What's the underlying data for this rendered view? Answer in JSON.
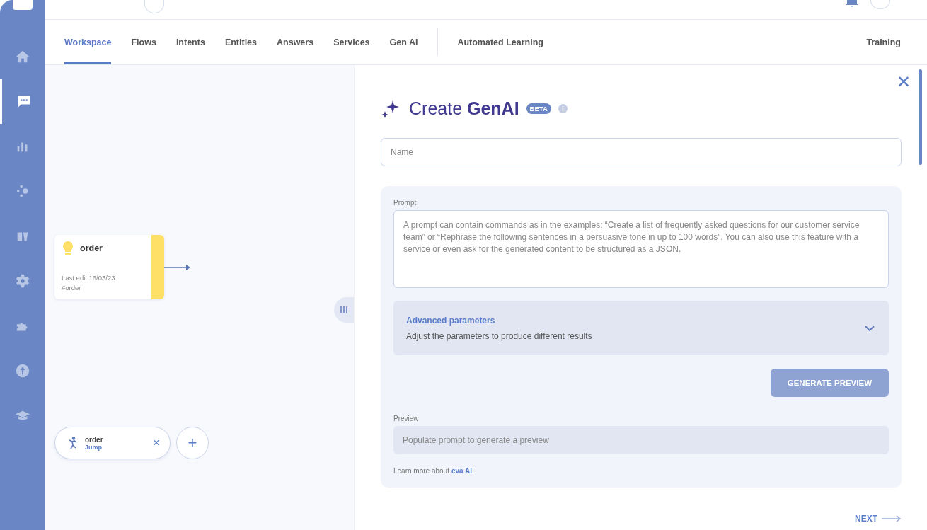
{
  "sidebar": {
    "items": [
      {
        "selected": false
      },
      {
        "selected": true
      },
      {
        "selected": false
      },
      {
        "selected": false
      },
      {
        "selected": false
      },
      {
        "selected": false
      },
      {
        "selected": false
      },
      {
        "selected": false
      },
      {
        "selected": false
      }
    ]
  },
  "tabs": [
    {
      "label": "Workspace",
      "selected": true
    },
    {
      "label": "Flows",
      "selected": false
    },
    {
      "label": "Intents",
      "selected": false
    },
    {
      "label": "Entities",
      "selected": false
    },
    {
      "label": "Answers",
      "selected": false
    },
    {
      "label": "Services",
      "selected": false
    },
    {
      "label": "Gen AI",
      "selected": false
    }
  ],
  "extra_tabs": [
    {
      "label": "Automated Learning",
      "selected": false
    }
  ],
  "right_tabs": [
    {
      "label": "Training",
      "selected": false
    }
  ],
  "canvas": {
    "node": {
      "title": "order",
      "last_edit": "Last edit 16/03/23",
      "tag": "#order",
      "color": "#ffe066"
    },
    "jump": {
      "title": "order",
      "subtitle": "Jump",
      "close": "×"
    },
    "add": "+"
  },
  "panel": {
    "close": "✕",
    "title": "Create **GenAI**",
    "badge": "BETA",
    "name_field": {
      "placeholder": "Name"
    },
    "prompt": {
      "label": "Prompt",
      "placeholder": "A prompt can contain commands as in the examples: “Create a list of frequently asked questions for our customer service team” or “Rephrase the following sentences in a persuasive tone in up to 100 words”. You can also use this feature with a service or even ask for the generated content to be structured as a JSON."
    },
    "advanced": {
      "title": "Advanced parameters",
      "subtitle": "Adjust the parameters to produce different results",
      "expanded": false
    },
    "generate": {
      "label": "GENERATE PREVIEW",
      "disabled": true
    },
    "preview": {
      "label": "Preview",
      "placeholder": "Populate prompt to generate a preview"
    },
    "learn_more": {
      "text": "Learn more about",
      "link": "eva AI"
    },
    "next": "NEXT"
  }
}
